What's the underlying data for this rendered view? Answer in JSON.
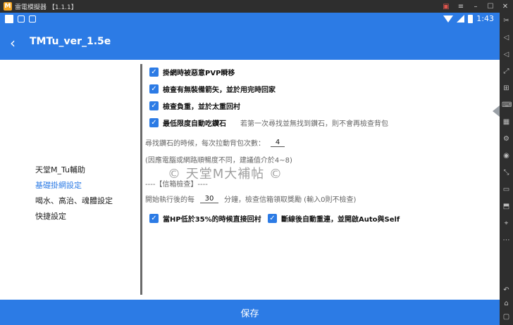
{
  "emulator": {
    "logo": "M",
    "title": "雷電模擬器 【1.1.1】",
    "controls": [
      "gamepad-icon",
      "menu-icon",
      "minimize-icon",
      "maximize-icon",
      "close-icon"
    ]
  },
  "statusbar": {
    "time": "1:43"
  },
  "appbar": {
    "back": "‹",
    "title": "TMTu_ver_1.5e"
  },
  "sidebar": {
    "items": [
      {
        "label": "天堂M_Tu輔助",
        "active": false
      },
      {
        "label": "基礎掛網設定",
        "active": true
      },
      {
        "label": "喝水、高治、魂體設定",
        "active": false
      },
      {
        "label": "快捷設定",
        "active": false
      }
    ]
  },
  "settings": {
    "check1": "掛網時被惡意PVP瞬移",
    "check2": "檢查有無裝備箭矢，並於用完時回家",
    "check3": "檢查負重，並於太重回村",
    "check4": "最低限度自動吃鑽石",
    "check4_hint": "若第一次尋找並無找到鑽石，則不會再檢查背包",
    "find_label": "尋找鑽石的時候，每次拉動背包次數：",
    "find_value": "4",
    "note": "(因應電腦或網路順暢度不同，建議值介於4~8)",
    "mailbox_header": "----【信箱檢查】----",
    "mail_prefix": "開始執行後的每",
    "mail_value": "30",
    "mail_suffix": "分鐘，檢查信箱領取獎勵 (輸入0則不檢查)",
    "check5": "當HP低於35%的時候直接回村",
    "check6": "斷線後自動重連，並開啟Auto與Self"
  },
  "watermark": "© 天堂M大補帖 ©",
  "savebar": {
    "label": "保存"
  },
  "toolbar": {
    "icons": [
      "scissors-icon",
      "volume-up-icon",
      "volume-down-icon",
      "fullscreen-icon",
      "add-window-icon",
      "keyboard-icon",
      "cpu-icon",
      "settings-icon",
      "record-icon",
      "shake-icon",
      "screenshot-icon",
      "apk-icon",
      "location-icon",
      "more-icon",
      "back-icon",
      "home-icon",
      "recents-icon"
    ]
  }
}
